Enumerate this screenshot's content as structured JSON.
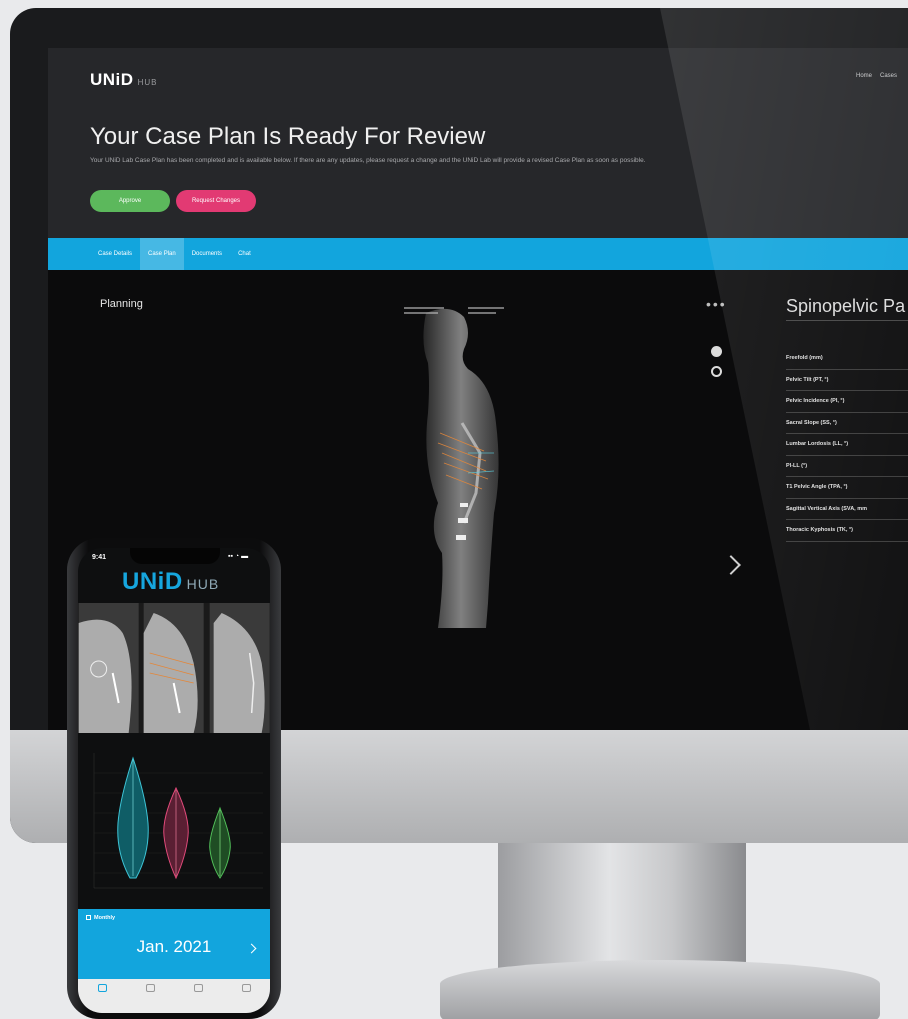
{
  "desktop": {
    "brand": "UNiD",
    "brand_sub": "HUB",
    "top_nav": [
      "Home",
      "Cases"
    ],
    "hero_title": "Your Case Plan Is Ready For Review",
    "hero_description": "Your UNiD Lab Case Plan has been completed and is available below. If there are any updates, please request a change and the UNiD Lab will provide a revised Case Plan as soon as possible.",
    "approve_label": "Approve",
    "request_label": "Request Changes",
    "tabs": [
      {
        "label": "Case Details",
        "active": false
      },
      {
        "label": "Case Plan",
        "active": true
      },
      {
        "label": "Documents",
        "active": false
      },
      {
        "label": "Chat",
        "active": false
      }
    ],
    "section_title": "Planning",
    "panel_title": "Spinopelvic Pa",
    "metrics": [
      "Freefold (mm)",
      "Pelvic Tilt (PT, °)",
      "Pelvic Incidence (PI, °)",
      "Sacral Slope (SS, °)",
      "Lumbar Lordosis (LL, °)",
      "PI-LL (°)",
      "T1 Pelvic Angle (TPA, °)",
      "Sagittal Vertical Axis (SVA, mm",
      "Thoracic Kyphosis (TK, °)"
    ],
    "colors": {
      "accent": "#12a5dd",
      "approve": "#5cb85c",
      "request": "#e23a73",
      "header": "#26272a"
    }
  },
  "phone": {
    "time": "9:41",
    "logo": "UNiD",
    "logo_sub": "HUB",
    "monthly_label": "Monthly",
    "month_value": "Jan. 2021",
    "tab_labels": [
      "",
      "",
      "",
      ""
    ]
  }
}
